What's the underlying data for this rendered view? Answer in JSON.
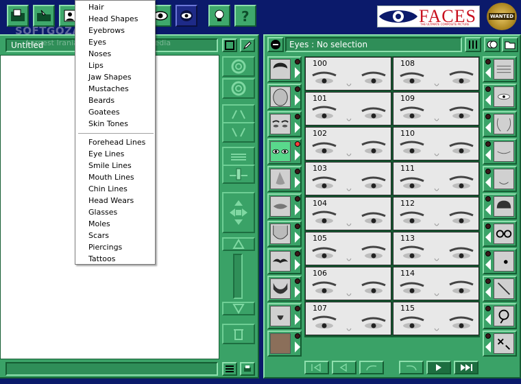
{
  "window": {
    "document_title": "Untitled",
    "category_label": "Eyes : No selection"
  },
  "toolbar": {
    "buttons": [
      "folder-open-icon",
      "hand-folder-icon",
      "portrait-icon",
      "eye-icon",
      "eye-mask-icon",
      "lightbulb-icon",
      "help-icon"
    ]
  },
  "branding": {
    "logo_text": "FACES",
    "logo_tagline": "THE ULTIMATE COMPOSITE PICTURE",
    "badge_text": "WANTED"
  },
  "watermark": {
    "line1": "SOFTGOZAR.COM",
    "line2": "Largest Iranian Software Encyclopedia"
  },
  "menu": {
    "group1": [
      "Hair",
      "Head Shapes",
      "Eyebrows",
      "Eyes",
      "Noses",
      "Lips",
      "Jaw Shapes",
      "Mustaches",
      "Beards",
      "Goatees",
      "Skin Tones"
    ],
    "group2": [
      "Forehead Lines",
      "Eye Lines",
      "Smile Lines",
      "Mouth Lines",
      "Chin Lines",
      "Head Wears",
      "Glasses",
      "Moles",
      "Scars",
      "Piercings",
      "Tattoos"
    ]
  },
  "library": {
    "left_column": [
      "Hair",
      "Head Shapes",
      "Eyebrows",
      "Eyes",
      "Noses",
      "Lips",
      "Jaw Shapes",
      "Mustaches",
      "Beards",
      "Goatees",
      "Skin Tones"
    ],
    "right_column": [
      "Forehead Lines",
      "Eye Lines",
      "Smile Lines",
      "Mouth Lines",
      "Chin Lines",
      "Head Wears",
      "Glasses",
      "Moles",
      "Scars",
      "Piercings",
      "Tattoos"
    ],
    "selected_category": "Eyes",
    "items_left": [
      "100",
      "101",
      "102",
      "103",
      "104",
      "105",
      "106",
      "107"
    ],
    "items_right": [
      "108",
      "109",
      "110",
      "111",
      "112",
      "113",
      "114",
      "115"
    ]
  },
  "colors": {
    "panel_green": "#3aa267",
    "background_blue": "#0b1a6b",
    "selected_led": "#ff3b3b"
  }
}
